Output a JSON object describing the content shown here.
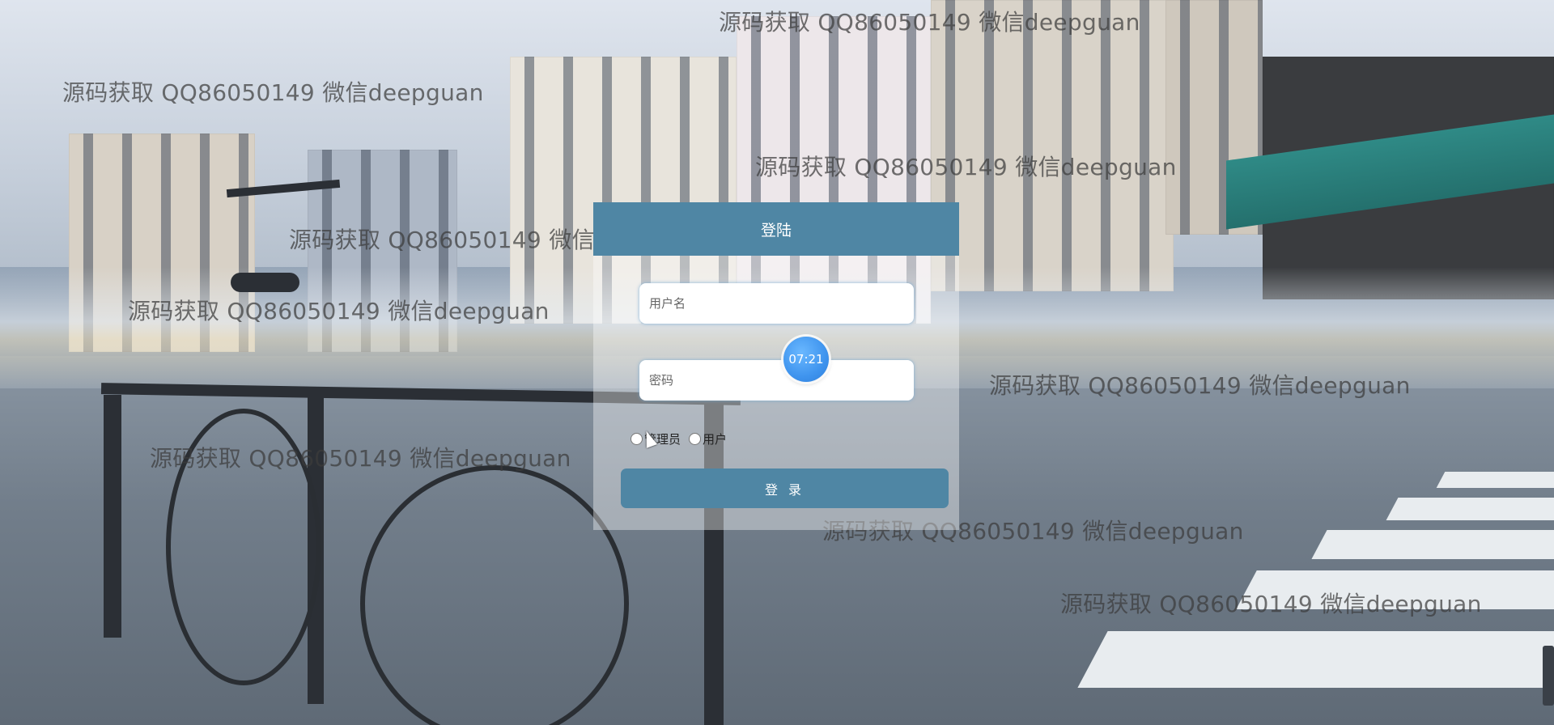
{
  "login": {
    "title": "登陆",
    "username_placeholder": "用户名",
    "password_placeholder": "密码",
    "roles": [
      "管理员",
      "用户"
    ],
    "submit_label": "登 录"
  },
  "clock": {
    "time": "07:21"
  },
  "watermark": {
    "text": "源码获取 QQ86050149 微信deepguan"
  },
  "colors": {
    "header": "#4f86a4",
    "button": "#4f86a4",
    "clock": "#3f94ee"
  }
}
